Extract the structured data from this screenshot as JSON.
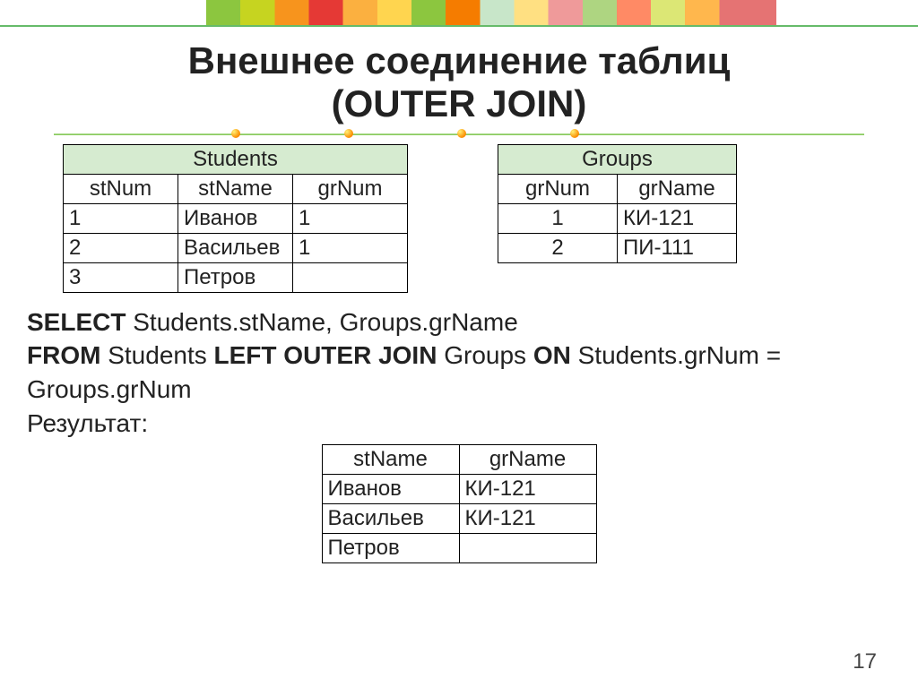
{
  "title_line1": "Внешнее соединение таблиц",
  "title_line2": "(OUTER JOIN)",
  "students": {
    "caption": "Students",
    "h1": "stNum",
    "h2": "stName",
    "h3": "grNum",
    "rows": [
      {
        "c1": "1",
        "c2": "Иванов",
        "c3": "1"
      },
      {
        "c1": "2",
        "c2": "Васильев",
        "c3": "1"
      },
      {
        "c1": "3",
        "c2": "Петров",
        "c3": ""
      }
    ]
  },
  "groups": {
    "caption": "Groups",
    "h1": "grNum",
    "h2": "grName",
    "rows": [
      {
        "c1": "1",
        "c2": "КИ-121"
      },
      {
        "c1": "2",
        "c2": "ПИ-111"
      }
    ]
  },
  "sql": {
    "kw_select": "SELECT",
    "select_cols": " Students.stName, Groups.grName",
    "kw_from": "FROM",
    "after_from": " Students ",
    "kw_leftjoin": "LEFT OUTER JOIN",
    "after_join": " Groups ",
    "kw_on": "ON",
    "on_cond": " Students.grNum = Groups.grNum",
    "result_label": "Результат:"
  },
  "result": {
    "h1": "stName",
    "h2": "grName",
    "rows": [
      {
        "c1": "Иванов",
        "c2": "КИ-121"
      },
      {
        "c1": "Васильев",
        "c2": "КИ-121"
      },
      {
        "c1": "Петров",
        "c2": ""
      }
    ]
  },
  "page_number": "17"
}
